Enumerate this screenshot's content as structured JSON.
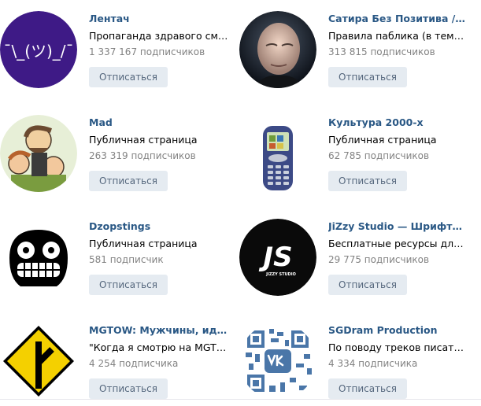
{
  "communities": [
    {
      "name": "Лентач",
      "description": "Пропаганда здравого смы…",
      "subscribers": "1 337 167 подписчиков",
      "button": "Отписаться",
      "avatar_text": "¯\\_(ツ)_/¯",
      "avatar_icon": "shrug-avatar-icon"
    },
    {
      "name": "Сатира Без Позитива / Нов…",
      "description": "Правила паблика (в темах)…",
      "subscribers": "313 815 подписчиков",
      "button": "Отписаться",
      "avatar_icon": "bald-man-photo-icon"
    },
    {
      "name": "Mad",
      "description": "Публичная страница",
      "subscribers": "263 319 подписчиков",
      "button": "Отписаться",
      "avatar_icon": "cartoon-men-avatar-icon"
    },
    {
      "name": "Культура 2000-х",
      "description": "Публичная страница",
      "subscribers": "62 785 подписчиков",
      "button": "Отписаться",
      "avatar_icon": "mobile-phone-avatar-icon"
    },
    {
      "name": "Dzopstings",
      "description": "Публичная страница",
      "subscribers": "581 подписчик",
      "button": "Отписаться",
      "avatar_icon": "skull-face-avatar-icon"
    },
    {
      "name": "JiZzy Studio — Шрифты / F…",
      "description": "Бесплатные ресурсы для д…",
      "subscribers": "29 775 подписчиков",
      "button": "Отписаться",
      "avatar_text": "JS",
      "avatar_subtext": "JIZZY STUDIO",
      "avatar_icon": "js-logo-avatar-icon"
    },
    {
      "name": "MGTOW: Мужчины, идущи…",
      "description": "\"Когда я смотрю на MGTO…",
      "subscribers": "4 254 подписчика",
      "button": "Отписаться",
      "avatar_icon": "road-sign-avatar-icon"
    },
    {
      "name": "SGDram Production",
      "description": "По поводу треков писать в …",
      "subscribers": "4 334 подписчика",
      "button": "Отписаться",
      "avatar_icon": "vk-qr-avatar-icon"
    }
  ],
  "colors": {
    "link": "#2a5885",
    "muted": "#828282",
    "button_bg": "#e5ebf1",
    "button_text": "#55677d",
    "lentach_purple": "#3e1a86"
  }
}
